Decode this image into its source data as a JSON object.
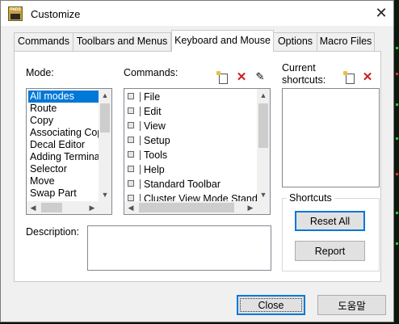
{
  "window": {
    "title": "Customize",
    "app_icon_label": "PADS"
  },
  "tabs": [
    {
      "label": "Commands"
    },
    {
      "label": "Toolbars and Menus"
    },
    {
      "label": "Keyboard and Mouse"
    },
    {
      "label": "Options"
    },
    {
      "label": "Macro Files"
    }
  ],
  "active_tab": "Keyboard and Mouse",
  "mode": {
    "label": "Mode:",
    "items": [
      "All modes",
      "Route",
      "Copy",
      "Associating Cop",
      "Decal Editor",
      "Adding Termina",
      "Selector",
      "Move",
      "Swap Part"
    ],
    "selected": "All modes"
  },
  "commands": {
    "label": "Commands:",
    "items": [
      "File",
      "Edit",
      "View",
      "Setup",
      "Tools",
      "Help",
      "Standard Toolbar",
      "Cluster View Mode Stand"
    ]
  },
  "shortcuts": {
    "label": "Current shortcuts:"
  },
  "description": {
    "label": "Description:",
    "value": ""
  },
  "shortcuts_group": {
    "title": "Shortcuts",
    "reset_all_label": "Reset All",
    "report_label": "Report"
  },
  "footer": {
    "close_label": "Close",
    "help_label": "도움말"
  },
  "colors": {
    "selection": "#0078d7",
    "delete_icon": "#c8201e"
  },
  "icons": [
    "app-icon",
    "close-icon",
    "new-icon",
    "delete-icon",
    "edit-icon",
    "scroll-up-icon",
    "scroll-down-icon",
    "scroll-left-icon",
    "scroll-right-icon",
    "command-folder-icon"
  ]
}
